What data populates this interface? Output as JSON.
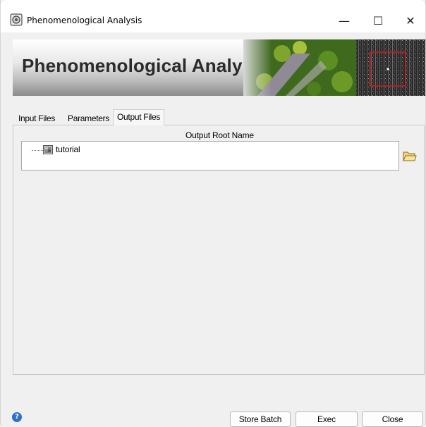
{
  "window": {
    "title": "Phenomenological Analysis",
    "controls": {
      "minimize": "—",
      "maximize": "☐",
      "close": "✕"
    }
  },
  "banner": {
    "title": "Phenomenological Analysis"
  },
  "tabs": [
    {
      "label": "Input Files",
      "active": false
    },
    {
      "label": "Parameters",
      "active": false
    },
    {
      "label": "Output Files",
      "active": true
    }
  ],
  "output": {
    "root_name_label": "Output Root Name",
    "tree_items": [
      {
        "label": "tutorial"
      }
    ]
  },
  "footer": {
    "help": "?",
    "buttons": {
      "store_batch": "Store Batch",
      "exec": "Exec",
      "close": "Close"
    }
  },
  "colors": {
    "accent_help": "#2f6fd0",
    "highlight_box": "#d01a1a"
  }
}
